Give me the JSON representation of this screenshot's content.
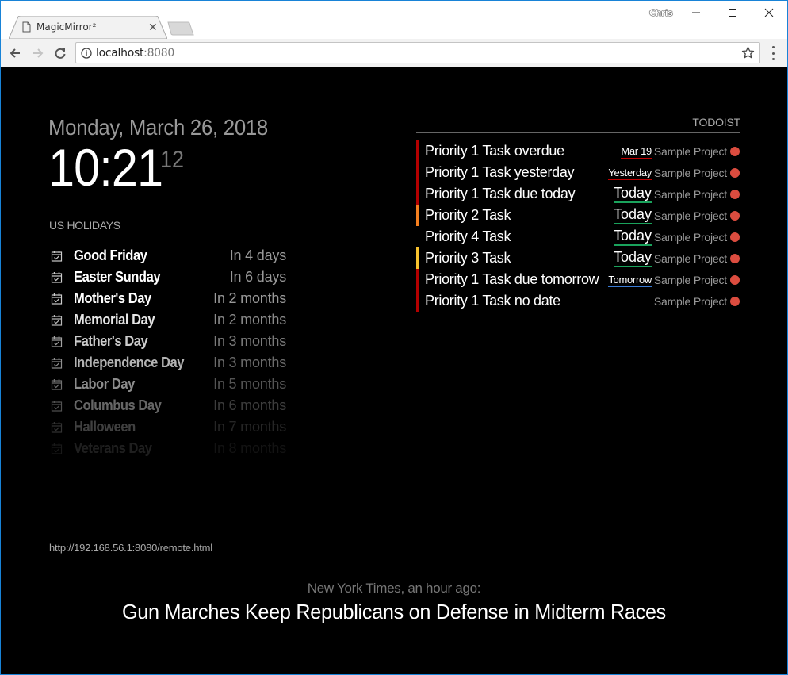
{
  "browser": {
    "tab_title": "MagicMirror²",
    "user_name": "Chris",
    "url_host": "localhost",
    "url_port": ":8080",
    "icons": {
      "tab": "document-icon",
      "close_tab": "close-icon",
      "back": "arrow-left-icon",
      "forward": "arrow-right-icon",
      "reload": "reload-icon",
      "site_info": "info-icon",
      "bookmark": "star-icon",
      "menu": "kebab-menu-icon"
    }
  },
  "clock": {
    "date": "Monday, March 26, 2018",
    "time": "10:21",
    "seconds": "12"
  },
  "holidays": {
    "header": "US Holidays",
    "icon": "calendar-check-icon",
    "items": [
      {
        "name": "Good Friday",
        "when": "In 4 days",
        "opacity": 1.0
      },
      {
        "name": "Easter Sunday",
        "when": "In 6 days",
        "opacity": 1.0
      },
      {
        "name": "Mother's Day",
        "when": "In 2 months",
        "opacity": 1.0
      },
      {
        "name": "Memorial Day",
        "when": "In 2 months",
        "opacity": 0.9
      },
      {
        "name": "Father's Day",
        "when": "In 3 months",
        "opacity": 0.8
      },
      {
        "name": "Independence Day",
        "when": "In 3 months",
        "opacity": 0.7
      },
      {
        "name": "Labor Day",
        "when": "In 5 months",
        "opacity": 0.55
      },
      {
        "name": "Columbus Day",
        "when": "In 6 months",
        "opacity": 0.4
      },
      {
        "name": "Halloween",
        "when": "In 7 months",
        "opacity": 0.25
      },
      {
        "name": "Veterans Day",
        "when": "In 8 months",
        "opacity": 0.12
      }
    ]
  },
  "todoist": {
    "header": "Todoist",
    "colors": {
      "priority_1": "#b30000",
      "priority_2": "#f57f1f",
      "priority_3": "#f8c22e",
      "project_dot": "#db4c3f",
      "due_today_underline": "#1aa35c",
      "due_overdue_underline": "#c00000",
      "due_tomorrow_underline": "#3a7bd5"
    },
    "tasks": [
      {
        "title": "Priority 1 Task overdue",
        "priority": 1,
        "due": "Mar 19",
        "due_style": "small",
        "project": "Sample Project"
      },
      {
        "title": "Priority 1 Task yesterday",
        "priority": 1,
        "due": "Yesterday",
        "due_style": "small",
        "project": "Sample Project"
      },
      {
        "title": "Priority 1 Task due today",
        "priority": 1,
        "due": "Today",
        "due_style": "big",
        "project": "Sample Project"
      },
      {
        "title": "Priority 2 Task",
        "priority": 2,
        "due": "Today",
        "due_style": "big",
        "project": "Sample Project"
      },
      {
        "title": "Priority 4 Task",
        "priority": 4,
        "due": "Today",
        "due_style": "big",
        "project": "Sample Project"
      },
      {
        "title": "Priority 3 Task",
        "priority": 3,
        "due": "Today",
        "due_style": "big",
        "project": "Sample Project"
      },
      {
        "title": "Priority 1 Task due tomorrow",
        "priority": 1,
        "due": "Tomorrow",
        "due_style": "tomorrow",
        "project": "Sample Project"
      },
      {
        "title": "Priority 1 Task no date",
        "priority": 1,
        "due": "",
        "due_style": "none",
        "project": "Sample Project"
      }
    ]
  },
  "remote": {
    "url": "http://192.168.56.1:8080/remote.html"
  },
  "news": {
    "source": "New York Times, an hour ago:",
    "headline": "Gun Marches Keep Republicans on Defense in Midterm Races"
  }
}
